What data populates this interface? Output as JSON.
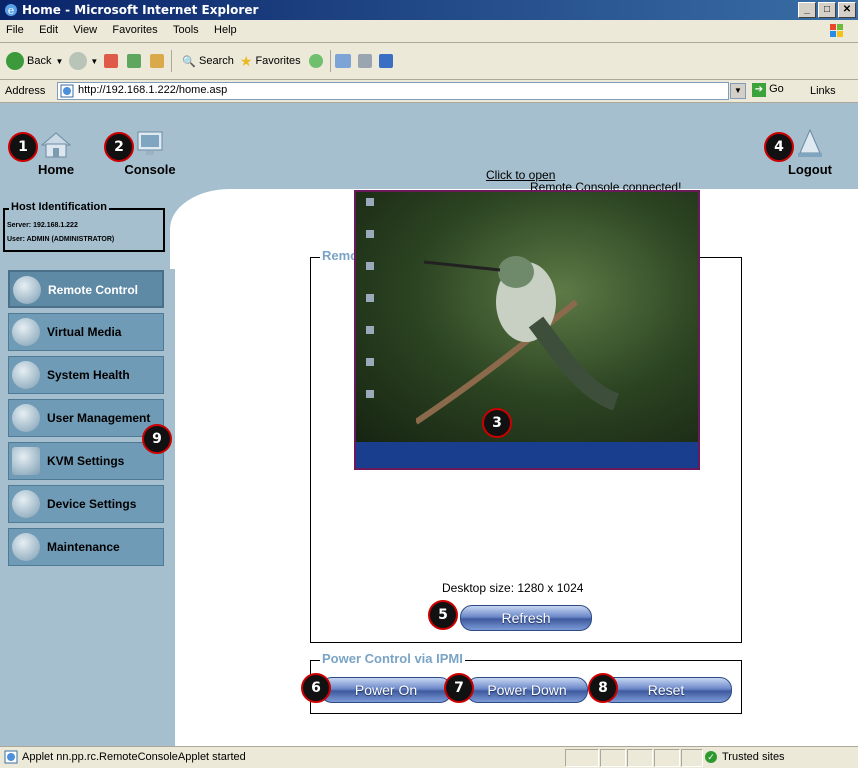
{
  "window": {
    "title": "Home - Microsoft Internet Explorer",
    "buttons": [
      "_",
      "□",
      "✕"
    ]
  },
  "menubar": [
    "File",
    "Edit",
    "View",
    "Favorites",
    "Tools",
    "Help"
  ],
  "toolbar": {
    "back": "Back",
    "search": "Search",
    "favorites": "Favorites"
  },
  "addressbar": {
    "label": "Address",
    "url": "http://192.168.1.222/home.asp",
    "go": "Go",
    "links": "Links"
  },
  "topnav": {
    "home": "Home",
    "console": "Console",
    "logout": "Logout",
    "status": "Remote Console connected!"
  },
  "host": {
    "legend": "Host Identification",
    "server": "Server: 192.168.1.222",
    "user": "User: ADMIN (ADMINISTRATOR)"
  },
  "sidebar": {
    "items": [
      {
        "label": "Remote Control",
        "icon": "magnifier-icon"
      },
      {
        "label": "Virtual Media",
        "icon": "disc-icon"
      },
      {
        "label": "System Health",
        "icon": "health-cross-icon"
      },
      {
        "label": "User Management",
        "icon": "users-icon"
      },
      {
        "label": "KVM Settings",
        "icon": "keyboard-icon"
      },
      {
        "label": "Device Settings",
        "icon": "gears-icon"
      },
      {
        "label": "Maintenance",
        "icon": "tools-icon"
      }
    ]
  },
  "preview": {
    "legend": "Remote Console Preview",
    "click_to_open": "Click to open",
    "desktop_size": "Desktop size: 1280 x 1024",
    "refresh": "Refresh"
  },
  "power": {
    "legend": "Power Control via IPMI",
    "on": "Power On",
    "down": "Power Down",
    "reset": "Reset"
  },
  "badges": [
    "1",
    "2",
    "3",
    "4",
    "5",
    "6",
    "7",
    "8",
    "9"
  ],
  "statusbar": {
    "message": "Applet nn.pp.rc.RemoteConsoleApplet started",
    "zone": "Trusted sites"
  }
}
